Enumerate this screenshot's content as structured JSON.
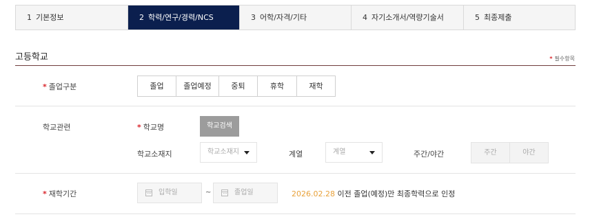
{
  "steps": [
    {
      "num": "1",
      "label": "기본정보"
    },
    {
      "num": "2",
      "label": "학력/연구/경력/NCS"
    },
    {
      "num": "3",
      "label": "어학/자격/기타"
    },
    {
      "num": "4",
      "label": "자기소개서/역량기술서"
    },
    {
      "num": "5",
      "label": "최종제출"
    }
  ],
  "active_step_index": 1,
  "section": {
    "title": "고등학교",
    "required_note": "필수항목"
  },
  "graduation": {
    "label": "졸업구분",
    "options": [
      "졸업",
      "졸업예정",
      "중퇴",
      "휴학",
      "재학"
    ]
  },
  "school": {
    "row_label": "학교관련",
    "name_label": "학교명",
    "search_button": "학교검색",
    "location_label": "학교소재지",
    "location_placeholder": "학교소재지",
    "track_label": "계열",
    "track_placeholder": "계열",
    "daynight_label": "주간/야간",
    "daynight_options": [
      "주간",
      "야간"
    ]
  },
  "period": {
    "label": "재학기간",
    "start_placeholder": "입학일",
    "end_placeholder": "졸업일",
    "separator": "~",
    "notice_date": "2026.02.28",
    "notice_text": " 이전 졸업(예정)만 최종학력으로 인정"
  },
  "colors": {
    "active_step_bg": "#0b1f4e",
    "required_star": "#d9262c",
    "notice_date": "#e8a13a"
  }
}
